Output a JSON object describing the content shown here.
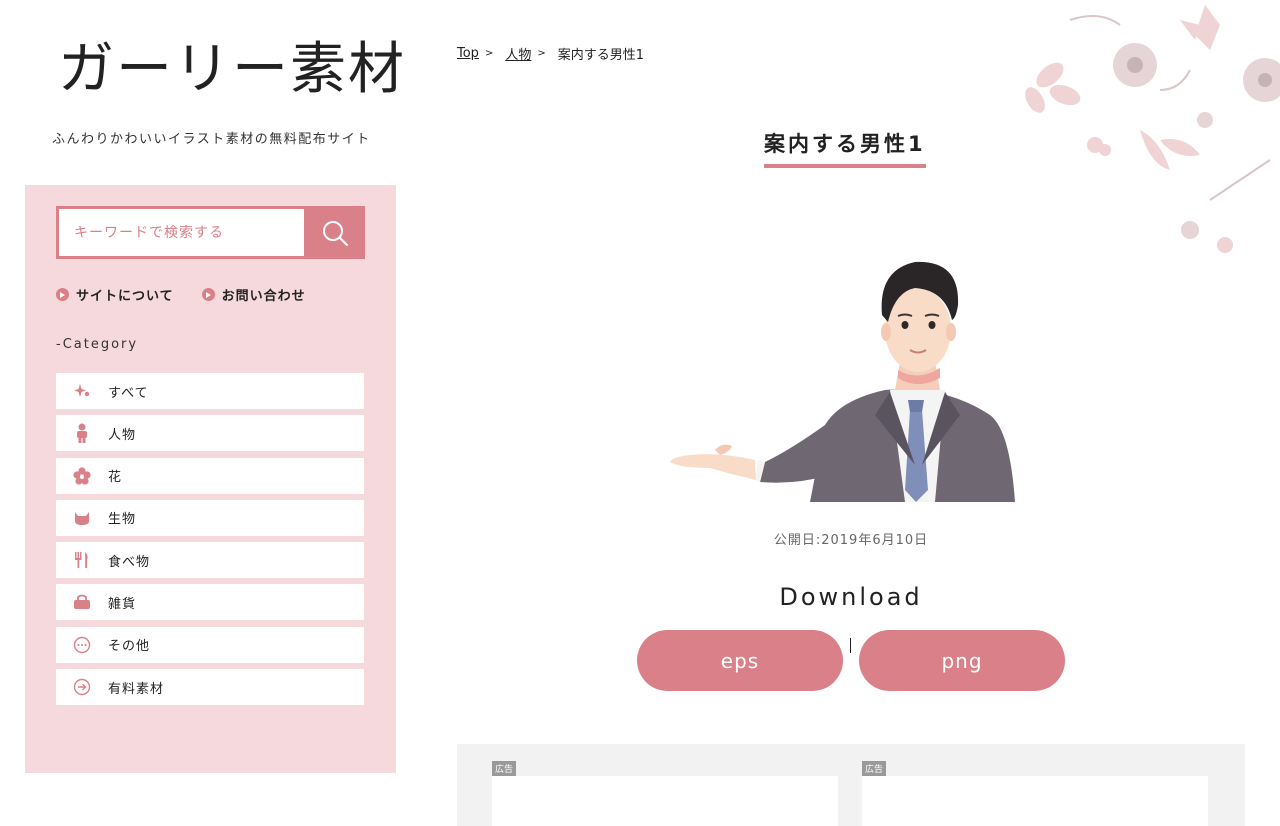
{
  "site": {
    "logo": "ガーリー素材",
    "tagline": "ふんわりかわいいイラスト素材の無料配布サイト"
  },
  "search": {
    "placeholder": "キーワードで検索する"
  },
  "site_links": [
    {
      "label": "サイトについて"
    },
    {
      "label": "お問い合わせ"
    }
  ],
  "category": {
    "heading": "-Category",
    "items": [
      {
        "label": "すべて",
        "icon": "sparkle-icon"
      },
      {
        "label": "人物",
        "icon": "person-icon"
      },
      {
        "label": "花",
        "icon": "flower-icon"
      },
      {
        "label": "生物",
        "icon": "cat-icon"
      },
      {
        "label": "食べ物",
        "icon": "fork-icon"
      },
      {
        "label": "雑貨",
        "icon": "bag-icon"
      },
      {
        "label": "その他",
        "icon": "more-icon"
      },
      {
        "label": "有料素材",
        "icon": "arrow-circle-icon"
      }
    ]
  },
  "breadcrumb": {
    "items": [
      "Top",
      "人物",
      "案内する男性1"
    ]
  },
  "main": {
    "title": "案内する男性1",
    "published": "公開日:2019年6月10日",
    "download_heading": "Download",
    "download_eps": "eps",
    "download_png": "png"
  },
  "ads": {
    "label": "広告"
  },
  "colors": {
    "accent": "#d98088",
    "sidebar_bg": "#f5d9dc"
  }
}
